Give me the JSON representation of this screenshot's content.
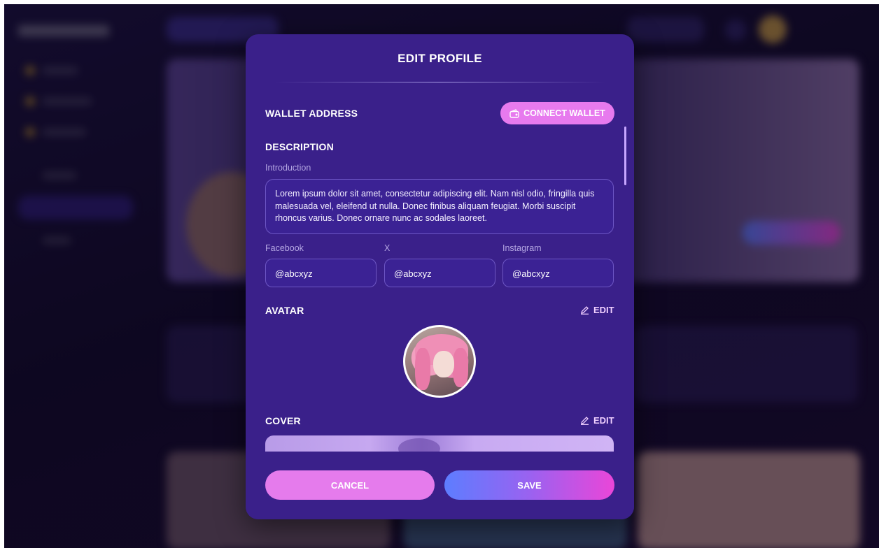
{
  "modal": {
    "title": "EDIT PROFILE",
    "wallet": {
      "label": "WALLET ADDRESS",
      "connect_button": "CONNECT WALLET",
      "connect_icon": "wallet-icon"
    },
    "description": {
      "label": "DESCRIPTION",
      "intro_label": "Introduction",
      "intro_text": "Lorem ipsum dolor sit amet, consectetur adipiscing elit. Nam nisl odio, fringilla quis malesuada vel, eleifend ut nulla. Donec finibus aliquam feugiat. Morbi suscipit rhoncus varius. Donec ornare nunc ac sodales laoreet."
    },
    "socials": [
      {
        "label": "Facebook",
        "value": "@abcxyz"
      },
      {
        "label": "X",
        "value": "@abcxyz"
      },
      {
        "label": "Instagram",
        "value": "@abcxyz"
      }
    ],
    "avatar": {
      "label": "AVATAR",
      "edit_label": "EDIT",
      "edit_icon": "pencil-icon"
    },
    "cover": {
      "label": "COVER",
      "edit_label": "EDIT",
      "edit_icon": "pencil-icon"
    },
    "cancel_label": "CANCEL",
    "save_label": "SAVE"
  },
  "colors": {
    "modal_bg": "#3a208a",
    "accent_pink": "#e77aee",
    "save_gradient_start": "#5d7dff",
    "save_gradient_end": "#ea46d8"
  }
}
